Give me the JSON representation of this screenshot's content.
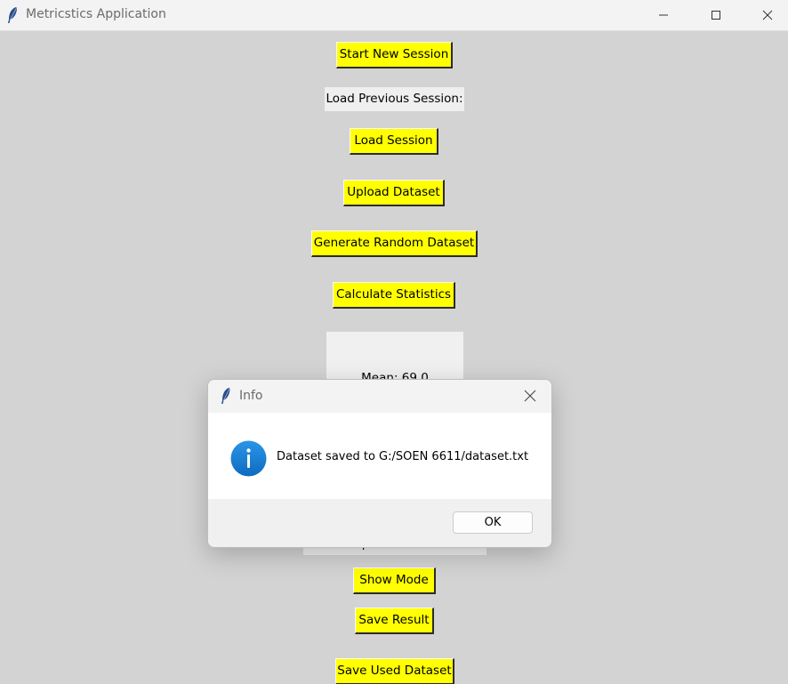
{
  "window": {
    "title": "Metricstics Application",
    "icons": {
      "app": "feather-icon",
      "minimize": "minimize-icon",
      "maximize": "maximize-icon",
      "close": "close-icon"
    }
  },
  "main": {
    "start_new_session": "Start New Session",
    "load_previous_label": "Load Previous Session:",
    "load_session": "Load Session",
    "upload_dataset": "Upload Dataset",
    "generate_random_dataset": "Generate Random Dataset",
    "calculate_statistics": "Calculate Statistics",
    "result_text": "Mean: 69.0",
    "status_text": "Dataset uploaded: 1111 values",
    "show_mode": "Show Mode",
    "save_result": "Save Result",
    "save_used_dataset": "Save Used Dataset"
  },
  "colors": {
    "button_bg": "#ffff00",
    "window_bg": "#d3d3d3",
    "info_icon": "#1a7fd4"
  },
  "dialog": {
    "title": "Info",
    "icon": "info-icon",
    "message": "Dataset saved to G:/SOEN 6611/dataset.txt",
    "ok_label": "OK"
  }
}
